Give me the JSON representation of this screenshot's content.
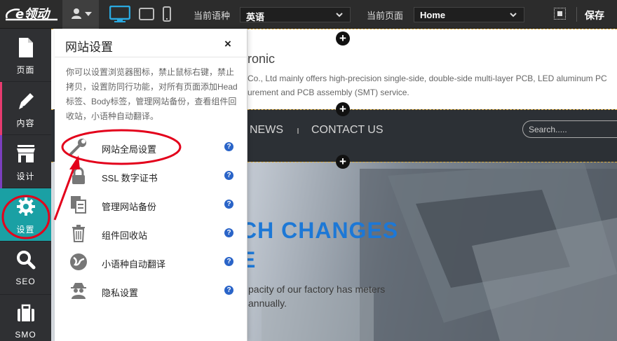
{
  "topbar": {
    "logo_text": "e领动",
    "lang_label": "当前语种",
    "lang_value": "英语",
    "page_label": "当前页面",
    "page_value": "Home",
    "save_label": "保存"
  },
  "leftnav": {
    "items": [
      {
        "label": "页面",
        "icon": "page-icon",
        "accent": "#ffffff"
      },
      {
        "label": "内容",
        "icon": "pencil-icon",
        "accent": "#e63b6f"
      },
      {
        "label": "设计",
        "icon": "store-icon",
        "accent": "#7b3fbf"
      },
      {
        "label": "设置",
        "icon": "gear-icon",
        "accent": "#1aa0a4"
      },
      {
        "label": "SEO",
        "icon": "search-icon",
        "accent": "#2f3033"
      },
      {
        "label": "SMO",
        "icon": "briefcase-icon",
        "accent": "#2f3033"
      }
    ]
  },
  "panel": {
    "title": "网站设置",
    "close": "×",
    "description": "你可以设置浏览器图标，禁止鼠标右键，禁止拷贝，设置防同行功能，对所有页面添加Head标签、Body标签，管理网站备份，查看组件回收站，小语种自动翻译。",
    "items": [
      {
        "label": "网站全局设置",
        "icon": "wrench-icon"
      },
      {
        "label": "SSL 数字证书",
        "icon": "lock-icon"
      },
      {
        "label": "管理网站备份",
        "icon": "backup-icon"
      },
      {
        "label": "组件回收站",
        "icon": "trash-icon"
      },
      {
        "label": "小语种自动翻译",
        "icon": "globe-icon"
      },
      {
        "label": "隐私设置",
        "icon": "spy-icon"
      }
    ],
    "help": "?"
  },
  "site": {
    "brand_partial": "ronic",
    "tagline": "Co., Ltd mainly offers high-precision single-side, double-side multi-layer PCB, LED aluminum PC urement and PCB assembly (SMT) service.",
    "nav_news": "NEWS",
    "nav_contact": "CONTACT US",
    "search_placeholder": "Search.....",
    "hero_line1": "CH CHANGES",
    "hero_line2": "E",
    "hero_text": "pacity of our factory has meters annually.",
    "add_symbol": "+"
  },
  "colors": {
    "topbar": "#2c2c2c",
    "active_nav": "#1aa0a4",
    "hero_blue": "#1d78d6",
    "annotation_red": "#e3001b",
    "help_blue": "#2a64c8"
  }
}
